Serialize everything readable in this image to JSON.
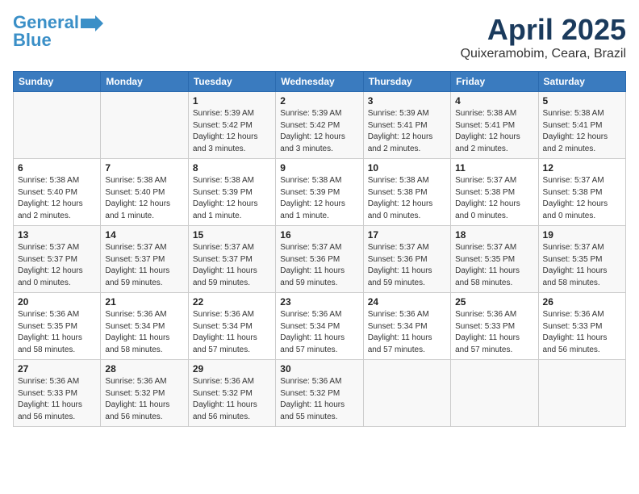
{
  "logo": {
    "line1": "General",
    "line2": "Blue"
  },
  "title": "April 2025",
  "subtitle": "Quixeramobim, Ceara, Brazil",
  "headers": [
    "Sunday",
    "Monday",
    "Tuesday",
    "Wednesday",
    "Thursday",
    "Friday",
    "Saturday"
  ],
  "weeks": [
    [
      {
        "day": "",
        "detail": ""
      },
      {
        "day": "",
        "detail": ""
      },
      {
        "day": "1",
        "detail": "Sunrise: 5:39 AM\nSunset: 5:42 PM\nDaylight: 12 hours\nand 3 minutes."
      },
      {
        "day": "2",
        "detail": "Sunrise: 5:39 AM\nSunset: 5:42 PM\nDaylight: 12 hours\nand 3 minutes."
      },
      {
        "day": "3",
        "detail": "Sunrise: 5:39 AM\nSunset: 5:41 PM\nDaylight: 12 hours\nand 2 minutes."
      },
      {
        "day": "4",
        "detail": "Sunrise: 5:38 AM\nSunset: 5:41 PM\nDaylight: 12 hours\nand 2 minutes."
      },
      {
        "day": "5",
        "detail": "Sunrise: 5:38 AM\nSunset: 5:41 PM\nDaylight: 12 hours\nand 2 minutes."
      }
    ],
    [
      {
        "day": "6",
        "detail": "Sunrise: 5:38 AM\nSunset: 5:40 PM\nDaylight: 12 hours\nand 2 minutes."
      },
      {
        "day": "7",
        "detail": "Sunrise: 5:38 AM\nSunset: 5:40 PM\nDaylight: 12 hours\nand 1 minute."
      },
      {
        "day": "8",
        "detail": "Sunrise: 5:38 AM\nSunset: 5:39 PM\nDaylight: 12 hours\nand 1 minute."
      },
      {
        "day": "9",
        "detail": "Sunrise: 5:38 AM\nSunset: 5:39 PM\nDaylight: 12 hours\nand 1 minute."
      },
      {
        "day": "10",
        "detail": "Sunrise: 5:38 AM\nSunset: 5:38 PM\nDaylight: 12 hours\nand 0 minutes."
      },
      {
        "day": "11",
        "detail": "Sunrise: 5:37 AM\nSunset: 5:38 PM\nDaylight: 12 hours\nand 0 minutes."
      },
      {
        "day": "12",
        "detail": "Sunrise: 5:37 AM\nSunset: 5:38 PM\nDaylight: 12 hours\nand 0 minutes."
      }
    ],
    [
      {
        "day": "13",
        "detail": "Sunrise: 5:37 AM\nSunset: 5:37 PM\nDaylight: 12 hours\nand 0 minutes."
      },
      {
        "day": "14",
        "detail": "Sunrise: 5:37 AM\nSunset: 5:37 PM\nDaylight: 11 hours\nand 59 minutes."
      },
      {
        "day": "15",
        "detail": "Sunrise: 5:37 AM\nSunset: 5:37 PM\nDaylight: 11 hours\nand 59 minutes."
      },
      {
        "day": "16",
        "detail": "Sunrise: 5:37 AM\nSunset: 5:36 PM\nDaylight: 11 hours\nand 59 minutes."
      },
      {
        "day": "17",
        "detail": "Sunrise: 5:37 AM\nSunset: 5:36 PM\nDaylight: 11 hours\nand 59 minutes."
      },
      {
        "day": "18",
        "detail": "Sunrise: 5:37 AM\nSunset: 5:35 PM\nDaylight: 11 hours\nand 58 minutes."
      },
      {
        "day": "19",
        "detail": "Sunrise: 5:37 AM\nSunset: 5:35 PM\nDaylight: 11 hours\nand 58 minutes."
      }
    ],
    [
      {
        "day": "20",
        "detail": "Sunrise: 5:36 AM\nSunset: 5:35 PM\nDaylight: 11 hours\nand 58 minutes."
      },
      {
        "day": "21",
        "detail": "Sunrise: 5:36 AM\nSunset: 5:34 PM\nDaylight: 11 hours\nand 58 minutes."
      },
      {
        "day": "22",
        "detail": "Sunrise: 5:36 AM\nSunset: 5:34 PM\nDaylight: 11 hours\nand 57 minutes."
      },
      {
        "day": "23",
        "detail": "Sunrise: 5:36 AM\nSunset: 5:34 PM\nDaylight: 11 hours\nand 57 minutes."
      },
      {
        "day": "24",
        "detail": "Sunrise: 5:36 AM\nSunset: 5:34 PM\nDaylight: 11 hours\nand 57 minutes."
      },
      {
        "day": "25",
        "detail": "Sunrise: 5:36 AM\nSunset: 5:33 PM\nDaylight: 11 hours\nand 57 minutes."
      },
      {
        "day": "26",
        "detail": "Sunrise: 5:36 AM\nSunset: 5:33 PM\nDaylight: 11 hours\nand 56 minutes."
      }
    ],
    [
      {
        "day": "27",
        "detail": "Sunrise: 5:36 AM\nSunset: 5:33 PM\nDaylight: 11 hours\nand 56 minutes."
      },
      {
        "day": "28",
        "detail": "Sunrise: 5:36 AM\nSunset: 5:32 PM\nDaylight: 11 hours\nand 56 minutes."
      },
      {
        "day": "29",
        "detail": "Sunrise: 5:36 AM\nSunset: 5:32 PM\nDaylight: 11 hours\nand 56 minutes."
      },
      {
        "day": "30",
        "detail": "Sunrise: 5:36 AM\nSunset: 5:32 PM\nDaylight: 11 hours\nand 55 minutes."
      },
      {
        "day": "",
        "detail": ""
      },
      {
        "day": "",
        "detail": ""
      },
      {
        "day": "",
        "detail": ""
      }
    ]
  ]
}
